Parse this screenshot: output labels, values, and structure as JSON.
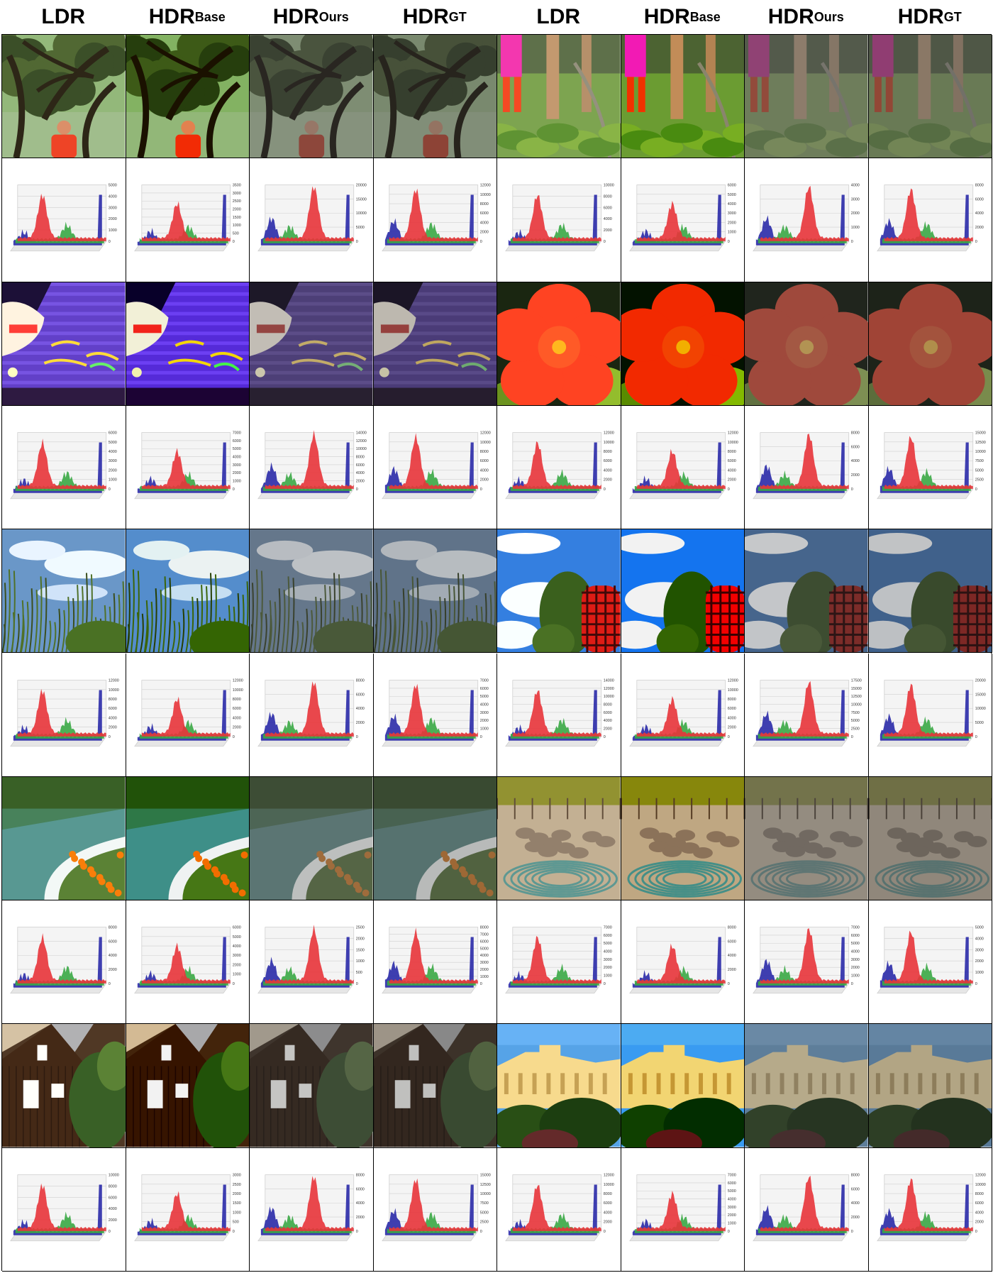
{
  "columns": [
    {
      "main": "LDR",
      "sub": ""
    },
    {
      "main": "HDR",
      "sub": "Base"
    },
    {
      "main": "HDR",
      "sub": "Ours"
    },
    {
      "main": "HDR",
      "sub": "GT"
    },
    {
      "main": "LDR",
      "sub": ""
    },
    {
      "main": "HDR",
      "sub": "Base"
    },
    {
      "main": "HDR",
      "sub": "Ours"
    },
    {
      "main": "HDR",
      "sub": "GT"
    }
  ],
  "scenes": [
    {
      "name": "tree-child",
      "kind": "tree",
      "side": "left"
    },
    {
      "name": "garden-legs",
      "kind": "garden",
      "side": "right"
    },
    {
      "name": "las-vegas-sign",
      "kind": "neon",
      "side": "left"
    },
    {
      "name": "red-flower",
      "kind": "flower",
      "side": "right"
    },
    {
      "name": "lake-reeds",
      "kind": "lake",
      "side": "left"
    },
    {
      "name": "sky-tree-red-shape",
      "kind": "sky",
      "side": "right"
    },
    {
      "name": "curved-walkway",
      "kind": "walkway",
      "side": "left"
    },
    {
      "name": "rocks-hose",
      "kind": "rocks",
      "side": "right"
    },
    {
      "name": "brown-house",
      "kind": "house",
      "side": "left"
    },
    {
      "name": "palace-trees",
      "kind": "palace",
      "side": "right"
    }
  ],
  "histograms": [
    {
      "ticks": [
        [
          "5000",
          "4000",
          "3000",
          "2000",
          "1000",
          "0"
        ],
        [
          "3500",
          "3000",
          "2500",
          "2000",
          "1500",
          "1000",
          "500",
          "0"
        ],
        [
          "20000",
          "15000",
          "10000",
          "5000",
          "0"
        ],
        [
          "12000",
          "10000",
          "8000",
          "6000",
          "4000",
          "2000",
          "0"
        ]
      ]
    },
    {
      "ticks": [
        [
          "10000",
          "8000",
          "6000",
          "4000",
          "2000",
          "0"
        ],
        [
          "6000",
          "5000",
          "4000",
          "3000",
          "2000",
          "1000",
          "0"
        ],
        [
          "4000",
          "3000",
          "2000",
          "1000",
          "0"
        ],
        [
          "8000",
          "6000",
          "4000",
          "2000",
          "0"
        ]
      ]
    },
    {
      "ticks": [
        [
          "6000",
          "5000",
          "4000",
          "3000",
          "2000",
          "1000",
          "0"
        ],
        [
          "7000",
          "6000",
          "5000",
          "4000",
          "3000",
          "2000",
          "1000",
          "0"
        ],
        [
          "14000",
          "12000",
          "10000",
          "8000",
          "6000",
          "4000",
          "2000",
          "0"
        ],
        [
          "12000",
          "10000",
          "8000",
          "6000",
          "4000",
          "2000",
          "0"
        ]
      ]
    },
    {
      "ticks": [
        [
          "12000",
          "10000",
          "8000",
          "6000",
          "4000",
          "2000",
          "0"
        ],
        [
          "12000",
          "10000",
          "8000",
          "6000",
          "4000",
          "2000",
          "0"
        ],
        [
          "8000",
          "6000",
          "4000",
          "2000",
          "0"
        ],
        [
          "15000",
          "12500",
          "10000",
          "7500",
          "5000",
          "2500",
          "0"
        ]
      ]
    },
    {
      "ticks": [
        [
          "12000",
          "10000",
          "8000",
          "6000",
          "4000",
          "2000",
          "0"
        ],
        [
          "12000",
          "10000",
          "8000",
          "6000",
          "4000",
          "2000",
          "0"
        ],
        [
          "8000",
          "6000",
          "4000",
          "2000",
          "0"
        ],
        [
          "7000",
          "6000",
          "5000",
          "4000",
          "3000",
          "2000",
          "1000",
          "0"
        ]
      ]
    },
    {
      "ticks": [
        [
          "14000",
          "12000",
          "10000",
          "8000",
          "6000",
          "4000",
          "2000",
          "0"
        ],
        [
          "12000",
          "10000",
          "8000",
          "6000",
          "4000",
          "2000",
          "0"
        ],
        [
          "17500",
          "15000",
          "12500",
          "10000",
          "7500",
          "5000",
          "2500",
          "0"
        ],
        [
          "20000",
          "15000",
          "10000",
          "5000",
          "0"
        ]
      ]
    },
    {
      "ticks": [
        [
          "8000",
          "6000",
          "4000",
          "2000",
          "0"
        ],
        [
          "6000",
          "5000",
          "4000",
          "3000",
          "2000",
          "1000",
          "0"
        ],
        [
          "2500",
          "2000",
          "1500",
          "1000",
          "500",
          "0"
        ],
        [
          "8000",
          "7000",
          "6000",
          "5000",
          "4000",
          "3000",
          "2000",
          "1000",
          "0"
        ]
      ]
    },
    {
      "ticks": [
        [
          "7000",
          "6000",
          "5000",
          "4000",
          "3000",
          "2000",
          "1000",
          "0"
        ],
        [
          "8000",
          "6000",
          "4000",
          "2000",
          "0"
        ],
        [
          "7000",
          "6000",
          "5000",
          "4000",
          "3000",
          "2000",
          "1000",
          "0"
        ],
        [
          "5000",
          "4000",
          "3000",
          "2000",
          "1000",
          "0"
        ]
      ]
    },
    {
      "ticks": [
        [
          "10000",
          "8000",
          "6000",
          "4000",
          "2000",
          "0"
        ],
        [
          "3000",
          "2500",
          "2000",
          "1500",
          "1000",
          "500",
          "0"
        ],
        [
          "8000",
          "6000",
          "4000",
          "2000",
          "0"
        ],
        [
          "15000",
          "12500",
          "10000",
          "7500",
          "5000",
          "2500",
          "0"
        ]
      ]
    },
    {
      "ticks": [
        [
          "12000",
          "10000",
          "8000",
          "6000",
          "4000",
          "2000",
          "0"
        ],
        [
          "7000",
          "6000",
          "5000",
          "4000",
          "3000",
          "2000",
          "1000",
          "0"
        ],
        [
          "8000",
          "6000",
          "4000",
          "2000",
          "0"
        ],
        [
          "12000",
          "10000",
          "8000",
          "6000",
          "4000",
          "2000",
          "0"
        ]
      ]
    }
  ],
  "colors": {
    "red": "#e8343a",
    "green": "#3aa845",
    "blue": "#2a2aa8",
    "grid": "#cfcfcf",
    "border": "#000000"
  }
}
